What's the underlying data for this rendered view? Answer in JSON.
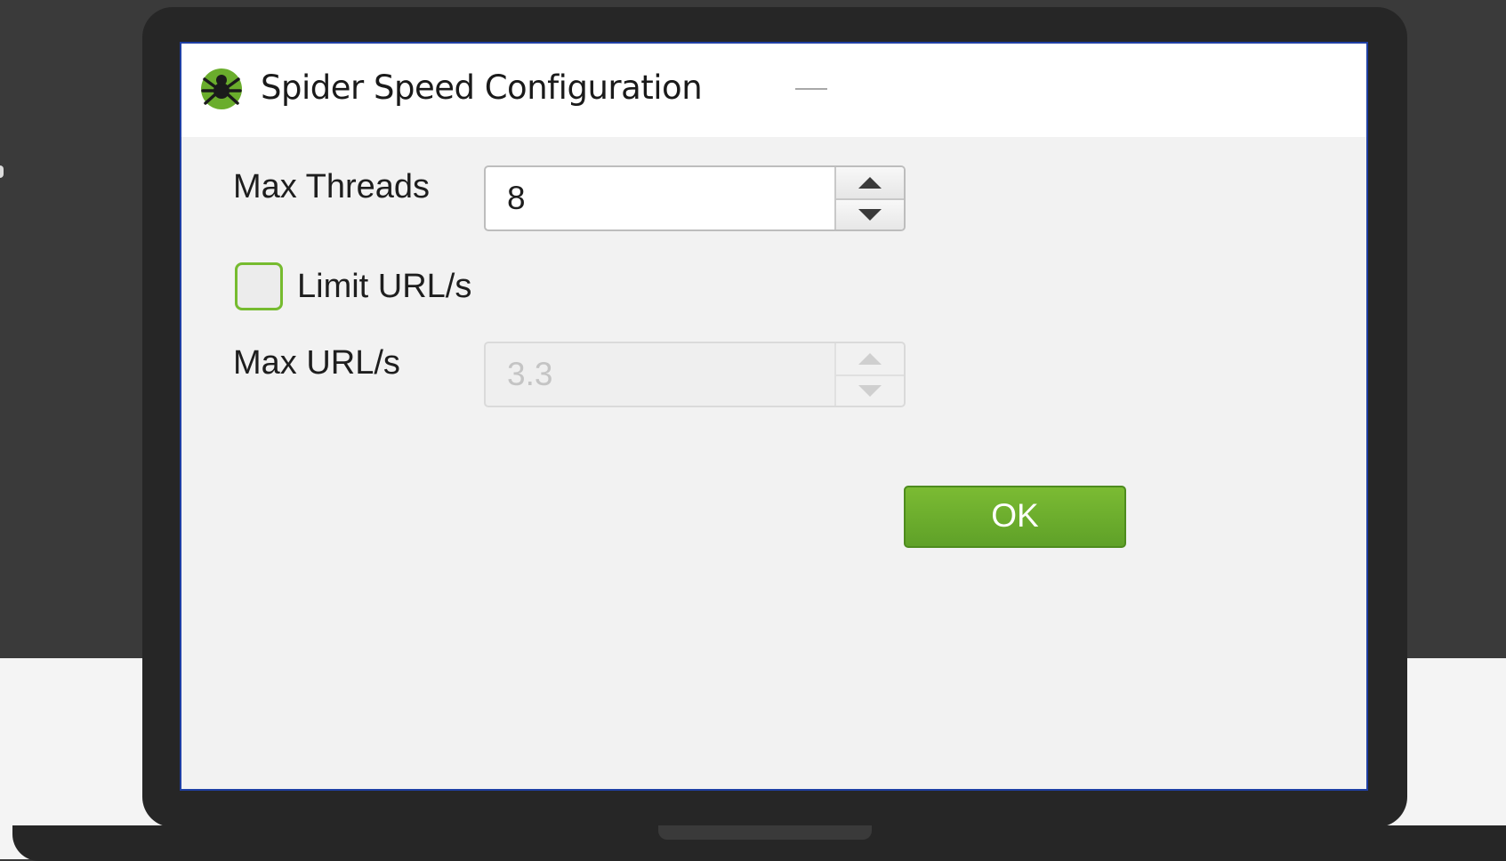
{
  "window": {
    "title": "Spider Speed Configuration",
    "icon": "spider-logo-icon"
  },
  "form": {
    "max_threads": {
      "label": "Max Threads",
      "value": "8"
    },
    "limit_urls": {
      "label": "Limit URL/s",
      "checked": false
    },
    "max_urls": {
      "label": "Max URL/s",
      "value": "3.3",
      "disabled": true
    }
  },
  "buttons": {
    "ok_label": "OK"
  },
  "colors": {
    "accent_green": "#6aad2c",
    "dialog_border": "#1f3fa3",
    "frame_dark": "#262626"
  }
}
